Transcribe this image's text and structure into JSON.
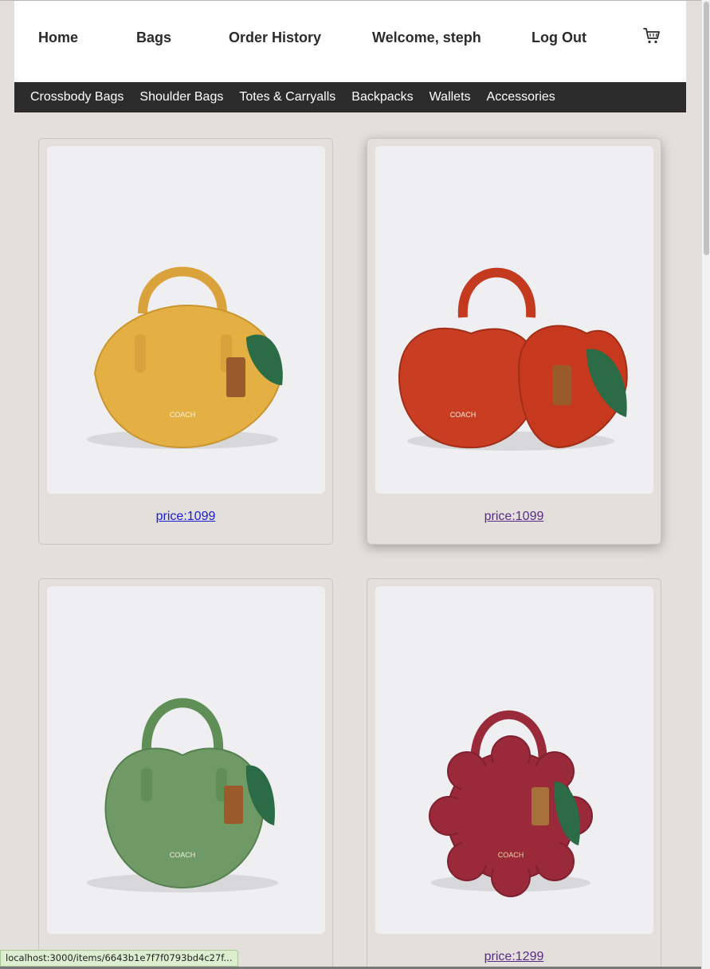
{
  "nav": {
    "home": "Home",
    "bags": "Bags",
    "orders": "Order History",
    "welcome": "Welcome, steph",
    "logout": "Log Out",
    "cart_icon": "cart-icon"
  },
  "categories": [
    "Crossbody Bags",
    "Shoulder Bags",
    "Totes & Carryalls",
    "Backpacks",
    "Wallets",
    "Accessories"
  ],
  "products": [
    {
      "price": "price:1099",
      "color": "#e5b043",
      "shape": "lemon"
    },
    {
      "price": "price:1099",
      "color": "#c93d22",
      "shape": "cherry"
    },
    {
      "price": "",
      "color": "#6f9a65",
      "shape": "apple"
    },
    {
      "price": "price:1299",
      "color": "#9a2a3a",
      "shape": "flower"
    }
  ],
  "status_url": "localhost:3000/items/6643b1e7f7f0793bd4c27f..."
}
